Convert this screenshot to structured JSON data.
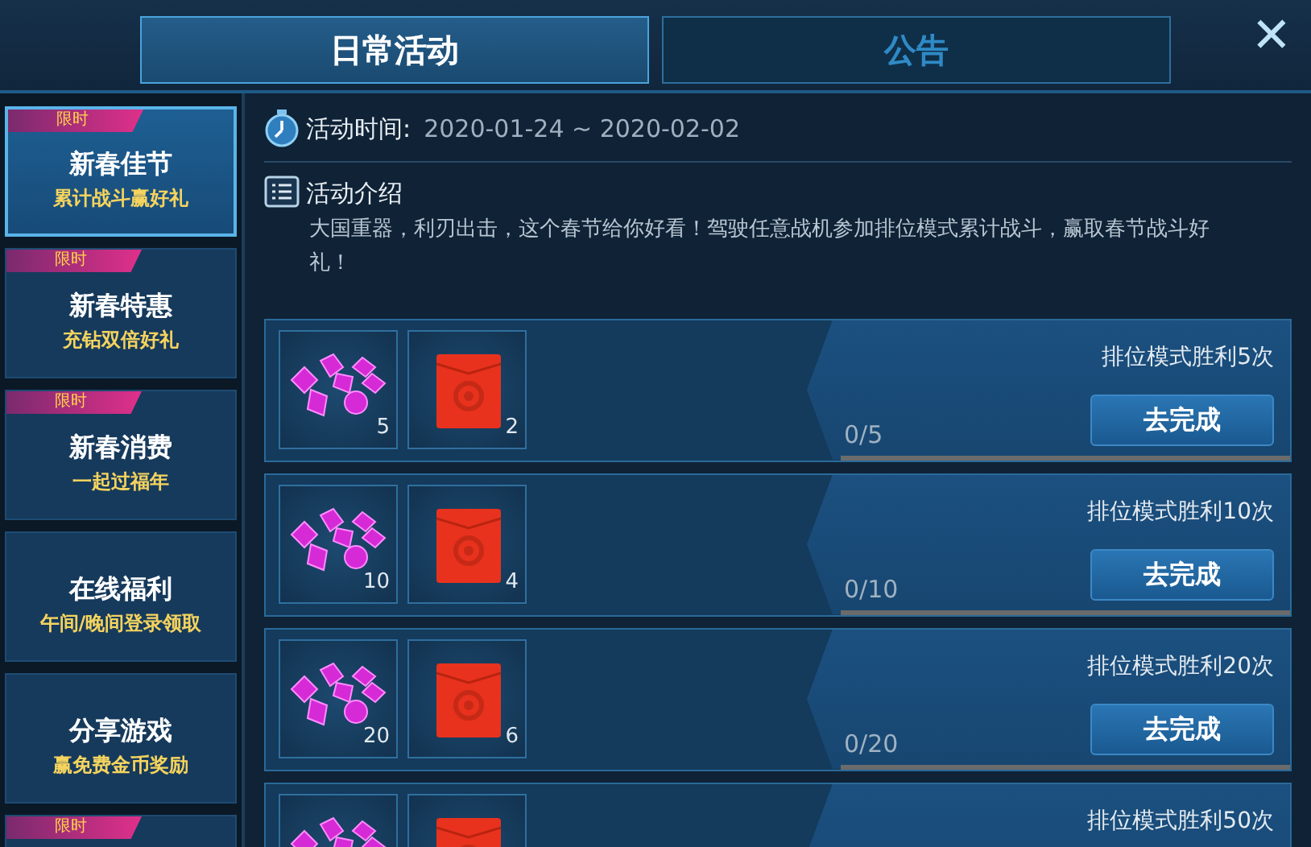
{
  "tabs": [
    {
      "label": "日常活动",
      "selected": true
    },
    {
      "label": "公告",
      "selected": false
    }
  ],
  "close": "✕",
  "sidebar": {
    "items": [
      {
        "tag": "限时",
        "title": "新春佳节",
        "subtitle": "累计战斗赢好礼",
        "selected": true
      },
      {
        "tag": "限时",
        "title": "新春特惠",
        "subtitle": "充钻双倍好礼",
        "selected": false
      },
      {
        "tag": "限时",
        "title": "新春消费",
        "subtitle": "一起过福年",
        "selected": false
      },
      {
        "title": "在线福利",
        "subtitle": "午间/晚间登录领取",
        "selected": false
      },
      {
        "title": "分享游戏",
        "subtitle": "赢免费金币奖励",
        "selected": false
      },
      {
        "tag": "限时",
        "selected": false
      }
    ]
  },
  "activity": {
    "time_label": "活动时间:",
    "time_value": "2020-01-24 ~ 2020-02-02",
    "intro_title": "活动介绍",
    "intro_text": "大国重器，利刃出击，这个春节给你好看！驾驶任意战机参加排位模式累计战斗，赢取春节战斗好礼！"
  },
  "tasks": [
    {
      "rewards": [
        {
          "kind": "gems",
          "count": "5"
        },
        {
          "kind": "envelope",
          "count": "2"
        }
      ],
      "title": "排位模式胜利5次",
      "progress": "0/5",
      "level": 0,
      "button": "去完成"
    },
    {
      "rewards": [
        {
          "kind": "gems",
          "count": "10"
        },
        {
          "kind": "envelope",
          "count": "4"
        }
      ],
      "title": "排位模式胜利10次",
      "progress": "0/10",
      "level": 0,
      "button": "去完成"
    },
    {
      "rewards": [
        {
          "kind": "gems",
          "count": "20"
        },
        {
          "kind": "envelope",
          "count": "6"
        }
      ],
      "title": "排位模式胜利20次",
      "progress": "0/20",
      "level": 0,
      "button": "去完成"
    },
    {
      "rewards": [
        {
          "kind": "gems"
        },
        {
          "kind": "envelope"
        }
      ],
      "title": "排位模式胜利50次"
    }
  ]
}
